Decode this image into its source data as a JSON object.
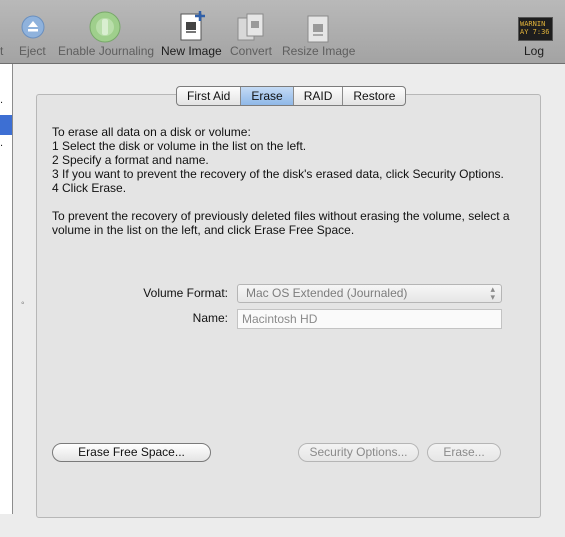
{
  "toolbar": {
    "items": [
      {
        "label": "t",
        "disabled": true
      },
      {
        "label": "Eject",
        "disabled": true
      },
      {
        "label": "Enable Journaling",
        "disabled": true
      },
      {
        "label": "New Image",
        "disabled": false
      },
      {
        "label": "Convert",
        "disabled": true
      },
      {
        "label": "Resize Image",
        "disabled": true
      },
      {
        "label": "Log",
        "disabled": false
      }
    ],
    "log_icon_text_1": "WARNIN",
    "log_icon_text_2": "AY 7:36 I"
  },
  "sidebar": {
    "rows": [
      ".",
      "",
      "."
    ]
  },
  "tabs": [
    "First Aid",
    "Erase",
    "RAID",
    "Restore"
  ],
  "active_tab": "Erase",
  "instructions": {
    "lines": [
      "To erase all data on a disk or volume:",
      "1 Select the disk or volume in the list on the left.",
      "2 Specify a format and name.",
      "3 If you want to prevent the recovery of the disk's erased data, click Security Options.",
      "4 Click Erase."
    ],
    "free_space_lines": [
      "To prevent the recovery of previously deleted files without erasing the volume, select a",
      "volume in the list on the left, and click Erase Free Space."
    ]
  },
  "form": {
    "volume_format_label": "Volume Format:",
    "volume_format_value": "Mac OS Extended (Journaled)",
    "name_label": "Name:",
    "name_value": "Macintosh HD"
  },
  "buttons": {
    "erase_free_space": "Erase Free Space...",
    "security_options": "Security Options...",
    "erase": "Erase..."
  },
  "colors": {
    "selection": "#3d6fd3",
    "tab_active": "#8fb8e8"
  }
}
